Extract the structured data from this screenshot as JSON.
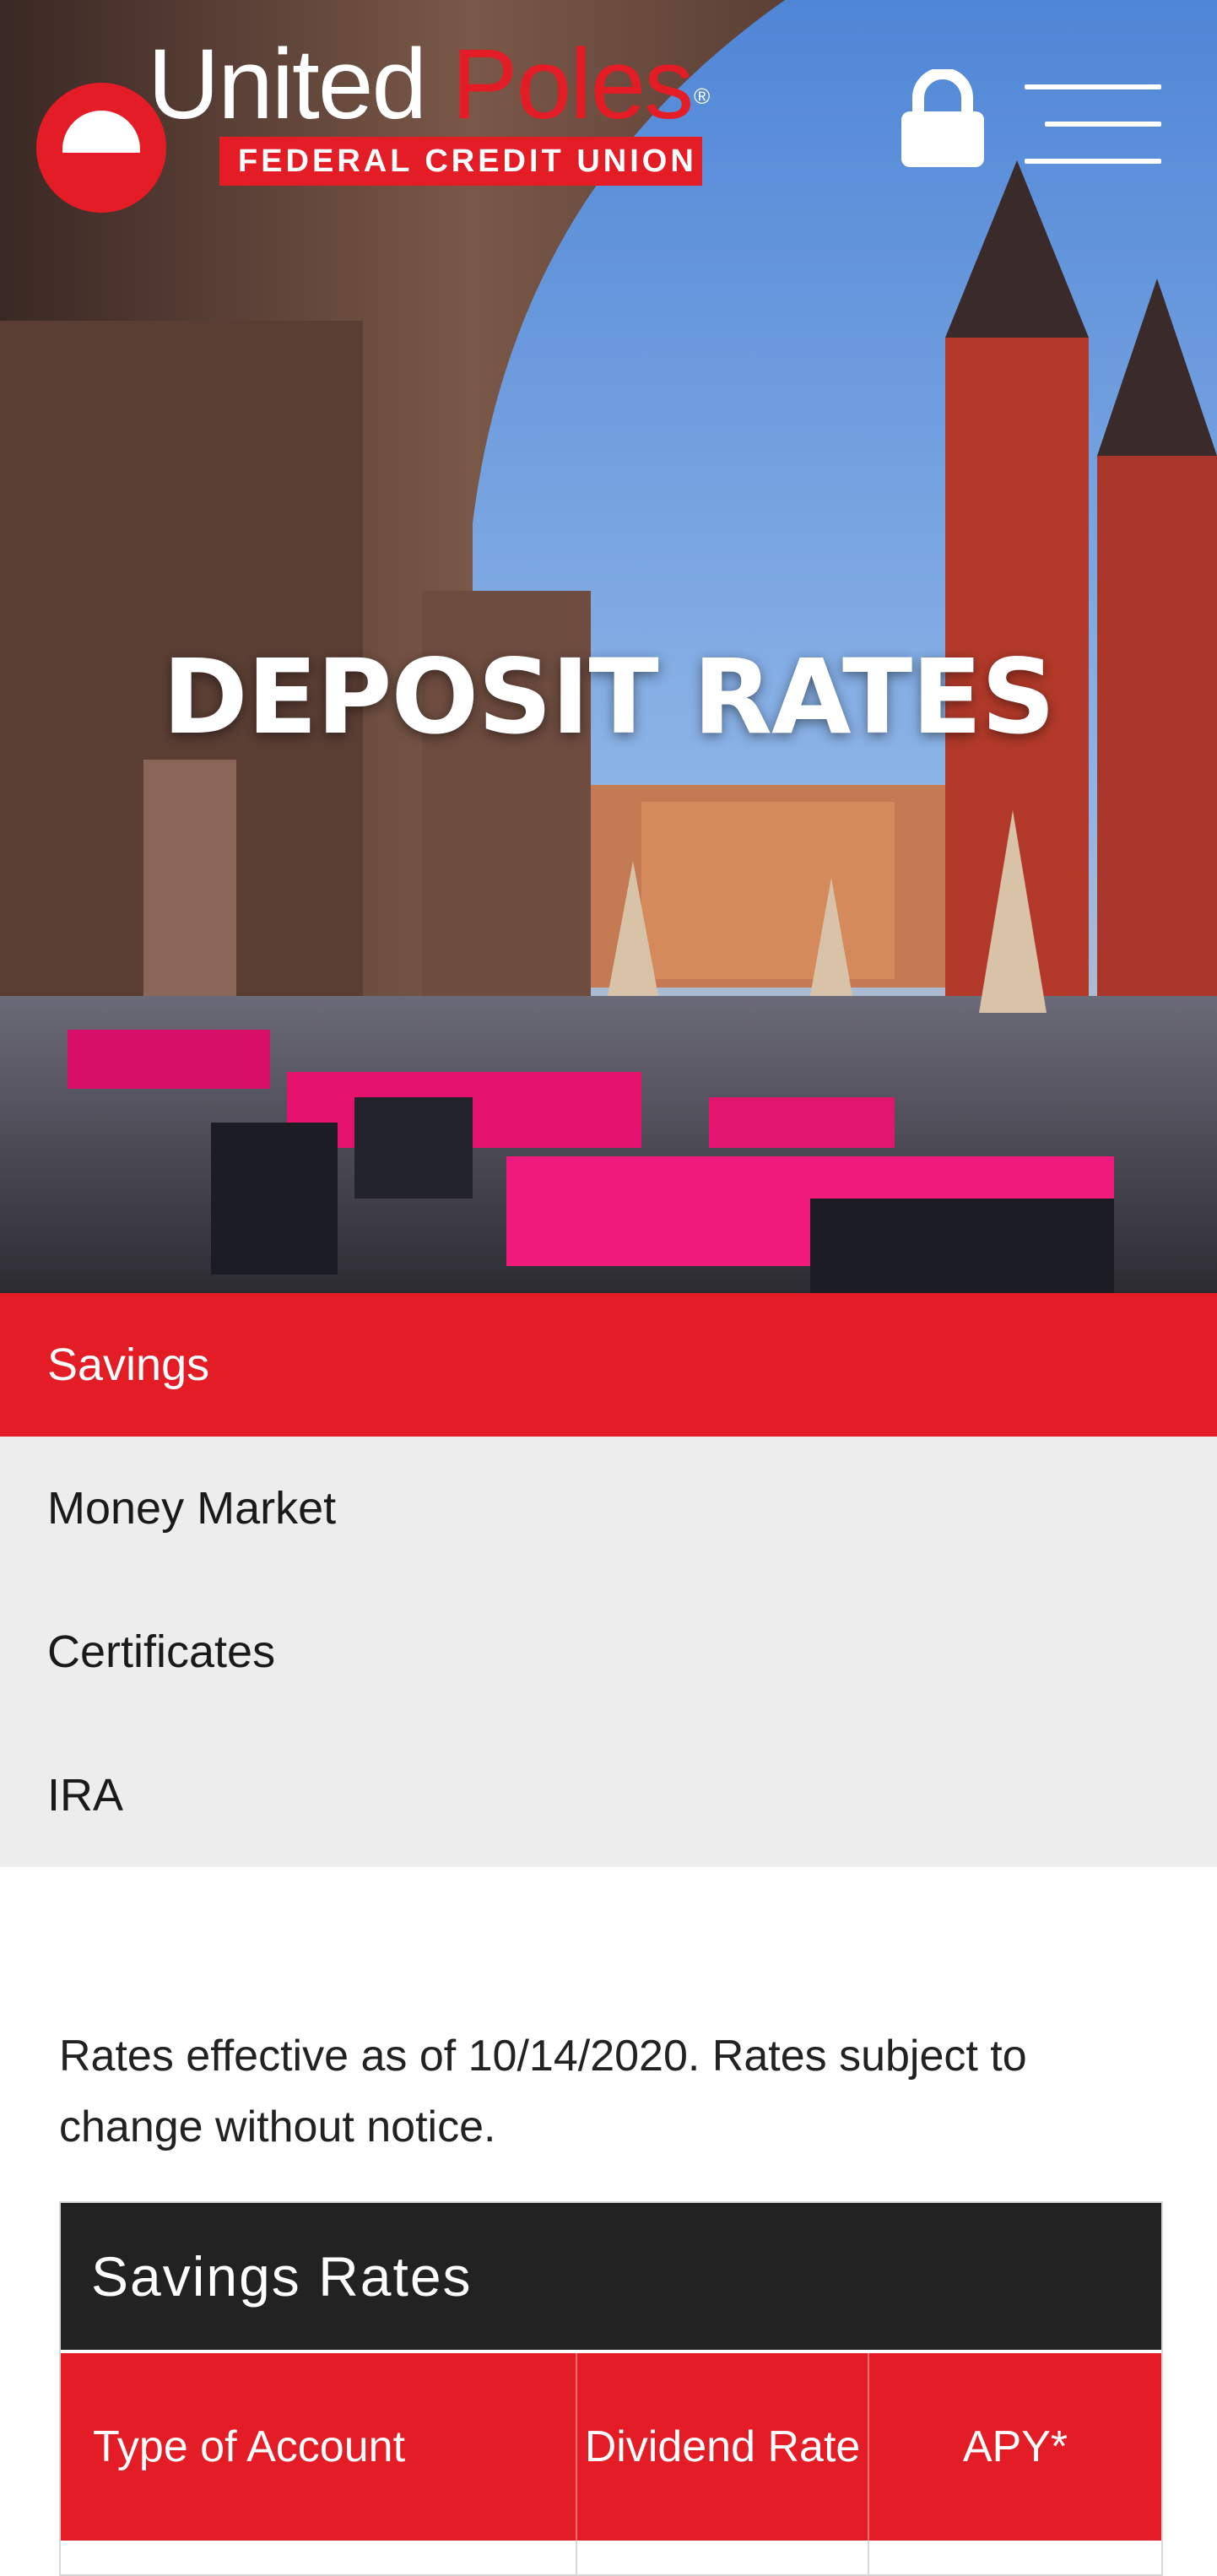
{
  "header": {
    "logo_word1": "United",
    "logo_word2": "Poles",
    "logo_registered": "®",
    "logo_tagline": "FEDERAL CREDIT UNION",
    "lock_icon": "lock-icon",
    "menu_icon": "hamburger-menu-icon"
  },
  "hero": {
    "title": "DEPOSIT RATES"
  },
  "subnav": {
    "items": [
      {
        "label": "Savings",
        "active": true
      },
      {
        "label": "Money Market",
        "active": false
      },
      {
        "label": "Certificates",
        "active": false
      },
      {
        "label": "IRA",
        "active": false
      }
    ]
  },
  "content": {
    "notice": "Rates effective as of 10/14/2020. Rates subject to change without notice."
  },
  "rates_table": {
    "caption": "Savings Rates",
    "columns": [
      "Type of Account",
      "Dividend Rate",
      "APY*"
    ]
  },
  "colors": {
    "brand_red": "#e31c25",
    "table_caption_bg": "#222222",
    "subnav_bg": "#ededed"
  }
}
